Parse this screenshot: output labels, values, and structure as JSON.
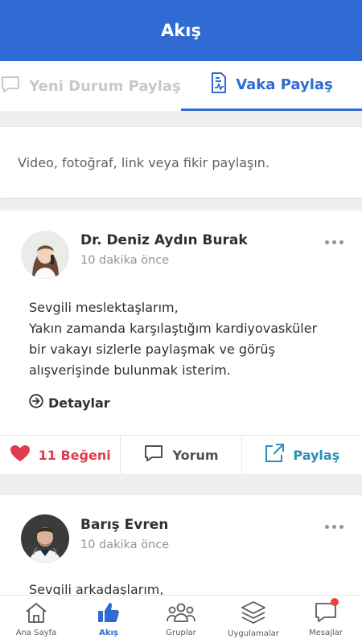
{
  "header": {
    "title": "Akış"
  },
  "tabs": [
    {
      "label": "Yeni Durum Paylaş",
      "icon": "chat-bubble-icon",
      "active": false
    },
    {
      "label": "Vaka Paylaş",
      "icon": "medical-file-icon",
      "active": true
    }
  ],
  "composer": {
    "placeholder": "Video, fotoğraf, link veya fikir paylaşın."
  },
  "posts": [
    {
      "author": "Dr. Deniz Aydın Burak",
      "time": "10 dakika önce",
      "body_line1": "Sevgili meslektaşlarım,",
      "body_line2": "Yakın zamanda karşılaştığım kardiyovasküler bir vakayı sizlerle paylaşmak ve görüş alışverişinde bulunmak isterim.",
      "details_label": "Detaylar",
      "like_label": "11 Beğeni",
      "comment_label": "Yorum",
      "share_label": "Paylaş"
    },
    {
      "author": "Barış Evren",
      "time": "10 dakika önce",
      "body_line1": "Sevgili arkadaşlarım,"
    }
  ],
  "bottom_nav": [
    {
      "label": "Ana Sayfa",
      "icon": "home-icon",
      "active": false
    },
    {
      "label": "Akış",
      "icon": "thumbs-up-icon",
      "active": true
    },
    {
      "label": "Gruplar",
      "icon": "group-icon",
      "active": false
    },
    {
      "label": "Uygulamalar",
      "icon": "layers-icon",
      "active": false
    },
    {
      "label": "Mesajlar",
      "icon": "message-icon",
      "active": false,
      "badge": true
    }
  ],
  "colors": {
    "primary": "#2f6bd3",
    "like": "#e03c4d",
    "share": "#2b8fb6",
    "badge": "#e8473f"
  }
}
